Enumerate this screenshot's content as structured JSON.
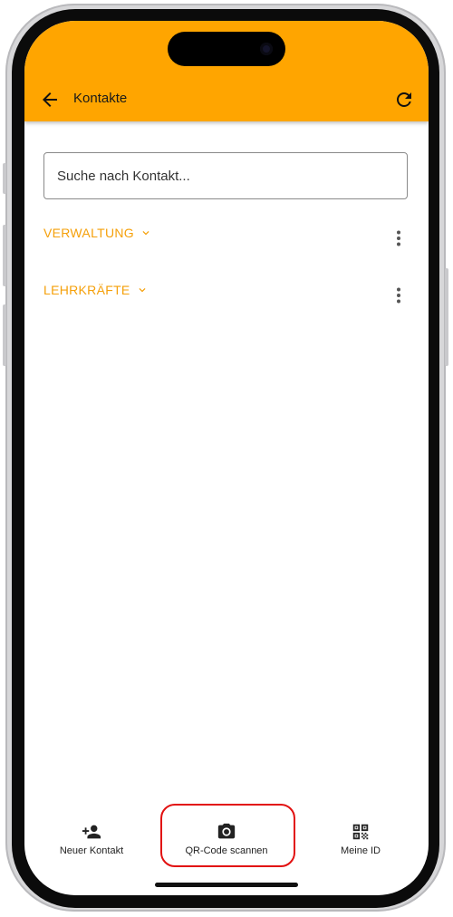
{
  "app_bar": {
    "title": "Kontakte",
    "back_icon": "arrow-back-icon",
    "refresh_icon": "refresh-icon",
    "color": "#ffa500"
  },
  "search": {
    "placeholder": "Suche nach Kontakt...",
    "value": ""
  },
  "groups": [
    {
      "label": "VERWALTUNG",
      "chevron_icon": "chevron-down-icon",
      "menu_icon": "more-vert-icon"
    },
    {
      "label": "LEHRKRÄFTE",
      "chevron_icon": "chevron-down-icon",
      "menu_icon": "more-vert-icon"
    }
  ],
  "bottom_nav": [
    {
      "label": "Neuer Kontakt",
      "icon": "person-add-icon"
    },
    {
      "label": "QR-Code scannen",
      "icon": "camera-icon",
      "highlighted": true
    },
    {
      "label": "Meine ID",
      "icon": "qr-code-icon"
    }
  ],
  "colors": {
    "accent": "#ffa500",
    "group_text": "#f5a00a",
    "highlight": "#e21010"
  }
}
